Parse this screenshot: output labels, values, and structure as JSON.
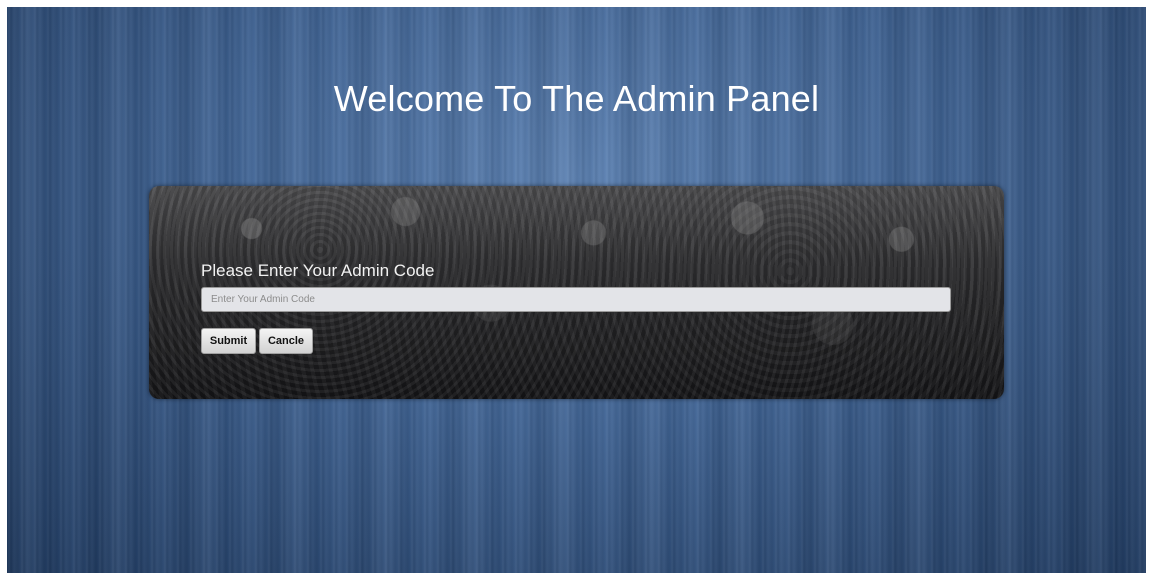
{
  "page": {
    "title": "Welcome To The Admin Panel"
  },
  "form": {
    "prompt": "Please Enter Your Admin Code",
    "code_input": {
      "value": "",
      "placeholder": "Enter Your Admin Code"
    },
    "submit_label": "Submit",
    "cancel_label": "Cancle"
  },
  "colors": {
    "background": "#3f6394",
    "panel": "#2e2e30",
    "text": "#ffffff",
    "input_bg": "#e3e4e8"
  }
}
